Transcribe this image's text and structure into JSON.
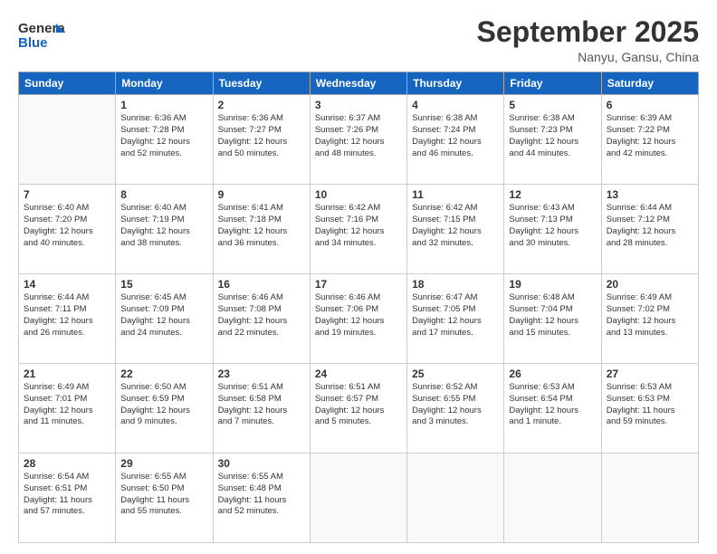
{
  "header": {
    "logo_general": "General",
    "logo_blue": "Blue",
    "month_title": "September 2025",
    "location": "Nanyu, Gansu, China"
  },
  "days_of_week": [
    "Sunday",
    "Monday",
    "Tuesday",
    "Wednesday",
    "Thursday",
    "Friday",
    "Saturday"
  ],
  "weeks": [
    [
      {
        "day": "",
        "lines": []
      },
      {
        "day": "1",
        "lines": [
          "Sunrise: 6:36 AM",
          "Sunset: 7:28 PM",
          "Daylight: 12 hours",
          "and 52 minutes."
        ]
      },
      {
        "day": "2",
        "lines": [
          "Sunrise: 6:36 AM",
          "Sunset: 7:27 PM",
          "Daylight: 12 hours",
          "and 50 minutes."
        ]
      },
      {
        "day": "3",
        "lines": [
          "Sunrise: 6:37 AM",
          "Sunset: 7:26 PM",
          "Daylight: 12 hours",
          "and 48 minutes."
        ]
      },
      {
        "day": "4",
        "lines": [
          "Sunrise: 6:38 AM",
          "Sunset: 7:24 PM",
          "Daylight: 12 hours",
          "and 46 minutes."
        ]
      },
      {
        "day": "5",
        "lines": [
          "Sunrise: 6:38 AM",
          "Sunset: 7:23 PM",
          "Daylight: 12 hours",
          "and 44 minutes."
        ]
      },
      {
        "day": "6",
        "lines": [
          "Sunrise: 6:39 AM",
          "Sunset: 7:22 PM",
          "Daylight: 12 hours",
          "and 42 minutes."
        ]
      }
    ],
    [
      {
        "day": "7",
        "lines": [
          "Sunrise: 6:40 AM",
          "Sunset: 7:20 PM",
          "Daylight: 12 hours",
          "and 40 minutes."
        ]
      },
      {
        "day": "8",
        "lines": [
          "Sunrise: 6:40 AM",
          "Sunset: 7:19 PM",
          "Daylight: 12 hours",
          "and 38 minutes."
        ]
      },
      {
        "day": "9",
        "lines": [
          "Sunrise: 6:41 AM",
          "Sunset: 7:18 PM",
          "Daylight: 12 hours",
          "and 36 minutes."
        ]
      },
      {
        "day": "10",
        "lines": [
          "Sunrise: 6:42 AM",
          "Sunset: 7:16 PM",
          "Daylight: 12 hours",
          "and 34 minutes."
        ]
      },
      {
        "day": "11",
        "lines": [
          "Sunrise: 6:42 AM",
          "Sunset: 7:15 PM",
          "Daylight: 12 hours",
          "and 32 minutes."
        ]
      },
      {
        "day": "12",
        "lines": [
          "Sunrise: 6:43 AM",
          "Sunset: 7:13 PM",
          "Daylight: 12 hours",
          "and 30 minutes."
        ]
      },
      {
        "day": "13",
        "lines": [
          "Sunrise: 6:44 AM",
          "Sunset: 7:12 PM",
          "Daylight: 12 hours",
          "and 28 minutes."
        ]
      }
    ],
    [
      {
        "day": "14",
        "lines": [
          "Sunrise: 6:44 AM",
          "Sunset: 7:11 PM",
          "Daylight: 12 hours",
          "and 26 minutes."
        ]
      },
      {
        "day": "15",
        "lines": [
          "Sunrise: 6:45 AM",
          "Sunset: 7:09 PM",
          "Daylight: 12 hours",
          "and 24 minutes."
        ]
      },
      {
        "day": "16",
        "lines": [
          "Sunrise: 6:46 AM",
          "Sunset: 7:08 PM",
          "Daylight: 12 hours",
          "and 22 minutes."
        ]
      },
      {
        "day": "17",
        "lines": [
          "Sunrise: 6:46 AM",
          "Sunset: 7:06 PM",
          "Daylight: 12 hours",
          "and 19 minutes."
        ]
      },
      {
        "day": "18",
        "lines": [
          "Sunrise: 6:47 AM",
          "Sunset: 7:05 PM",
          "Daylight: 12 hours",
          "and 17 minutes."
        ]
      },
      {
        "day": "19",
        "lines": [
          "Sunrise: 6:48 AM",
          "Sunset: 7:04 PM",
          "Daylight: 12 hours",
          "and 15 minutes."
        ]
      },
      {
        "day": "20",
        "lines": [
          "Sunrise: 6:49 AM",
          "Sunset: 7:02 PM",
          "Daylight: 12 hours",
          "and 13 minutes."
        ]
      }
    ],
    [
      {
        "day": "21",
        "lines": [
          "Sunrise: 6:49 AM",
          "Sunset: 7:01 PM",
          "Daylight: 12 hours",
          "and 11 minutes."
        ]
      },
      {
        "day": "22",
        "lines": [
          "Sunrise: 6:50 AM",
          "Sunset: 6:59 PM",
          "Daylight: 12 hours",
          "and 9 minutes."
        ]
      },
      {
        "day": "23",
        "lines": [
          "Sunrise: 6:51 AM",
          "Sunset: 6:58 PM",
          "Daylight: 12 hours",
          "and 7 minutes."
        ]
      },
      {
        "day": "24",
        "lines": [
          "Sunrise: 6:51 AM",
          "Sunset: 6:57 PM",
          "Daylight: 12 hours",
          "and 5 minutes."
        ]
      },
      {
        "day": "25",
        "lines": [
          "Sunrise: 6:52 AM",
          "Sunset: 6:55 PM",
          "Daylight: 12 hours",
          "and 3 minutes."
        ]
      },
      {
        "day": "26",
        "lines": [
          "Sunrise: 6:53 AM",
          "Sunset: 6:54 PM",
          "Daylight: 12 hours",
          "and 1 minute."
        ]
      },
      {
        "day": "27",
        "lines": [
          "Sunrise: 6:53 AM",
          "Sunset: 6:53 PM",
          "Daylight: 11 hours",
          "and 59 minutes."
        ]
      }
    ],
    [
      {
        "day": "28",
        "lines": [
          "Sunrise: 6:54 AM",
          "Sunset: 6:51 PM",
          "Daylight: 11 hours",
          "and 57 minutes."
        ]
      },
      {
        "day": "29",
        "lines": [
          "Sunrise: 6:55 AM",
          "Sunset: 6:50 PM",
          "Daylight: 11 hours",
          "and 55 minutes."
        ]
      },
      {
        "day": "30",
        "lines": [
          "Sunrise: 6:55 AM",
          "Sunset: 6:48 PM",
          "Daylight: 11 hours",
          "and 52 minutes."
        ]
      },
      {
        "day": "",
        "lines": []
      },
      {
        "day": "",
        "lines": []
      },
      {
        "day": "",
        "lines": []
      },
      {
        "day": "",
        "lines": []
      }
    ]
  ]
}
